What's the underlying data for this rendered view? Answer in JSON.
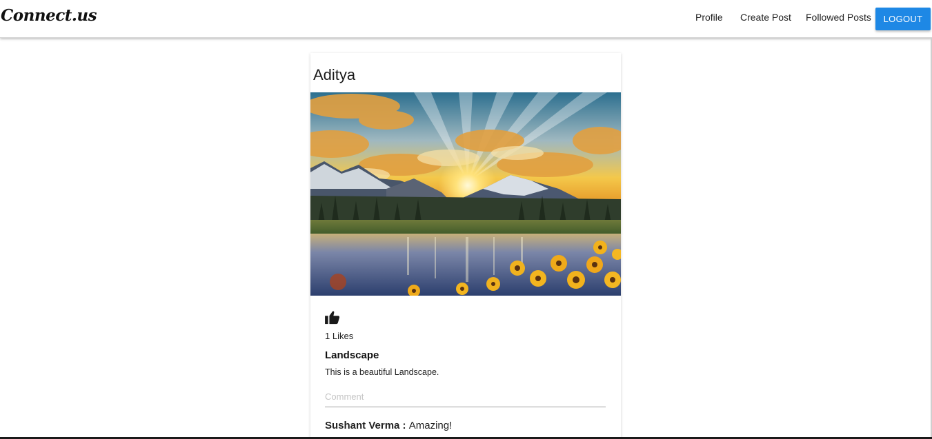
{
  "navbar": {
    "brand": "Connect.us",
    "links": {
      "profile": "Profile",
      "create_post": "Create Post",
      "followed_posts": "Followed Posts"
    },
    "logout_label": "LOGOUT",
    "accent_color": "#1e88e5"
  },
  "post": {
    "author": "Aditya",
    "image_alt": "landscape-photo",
    "like_icon": "thumbs-up-icon",
    "likes_text": "1 Likes",
    "title": "Landscape",
    "body": "This is a beautiful Landscape.",
    "comment_placeholder": "Comment",
    "comments": [
      {
        "author": "Sushant Verma",
        "separator": " : ",
        "text": "Amazing!"
      }
    ]
  }
}
